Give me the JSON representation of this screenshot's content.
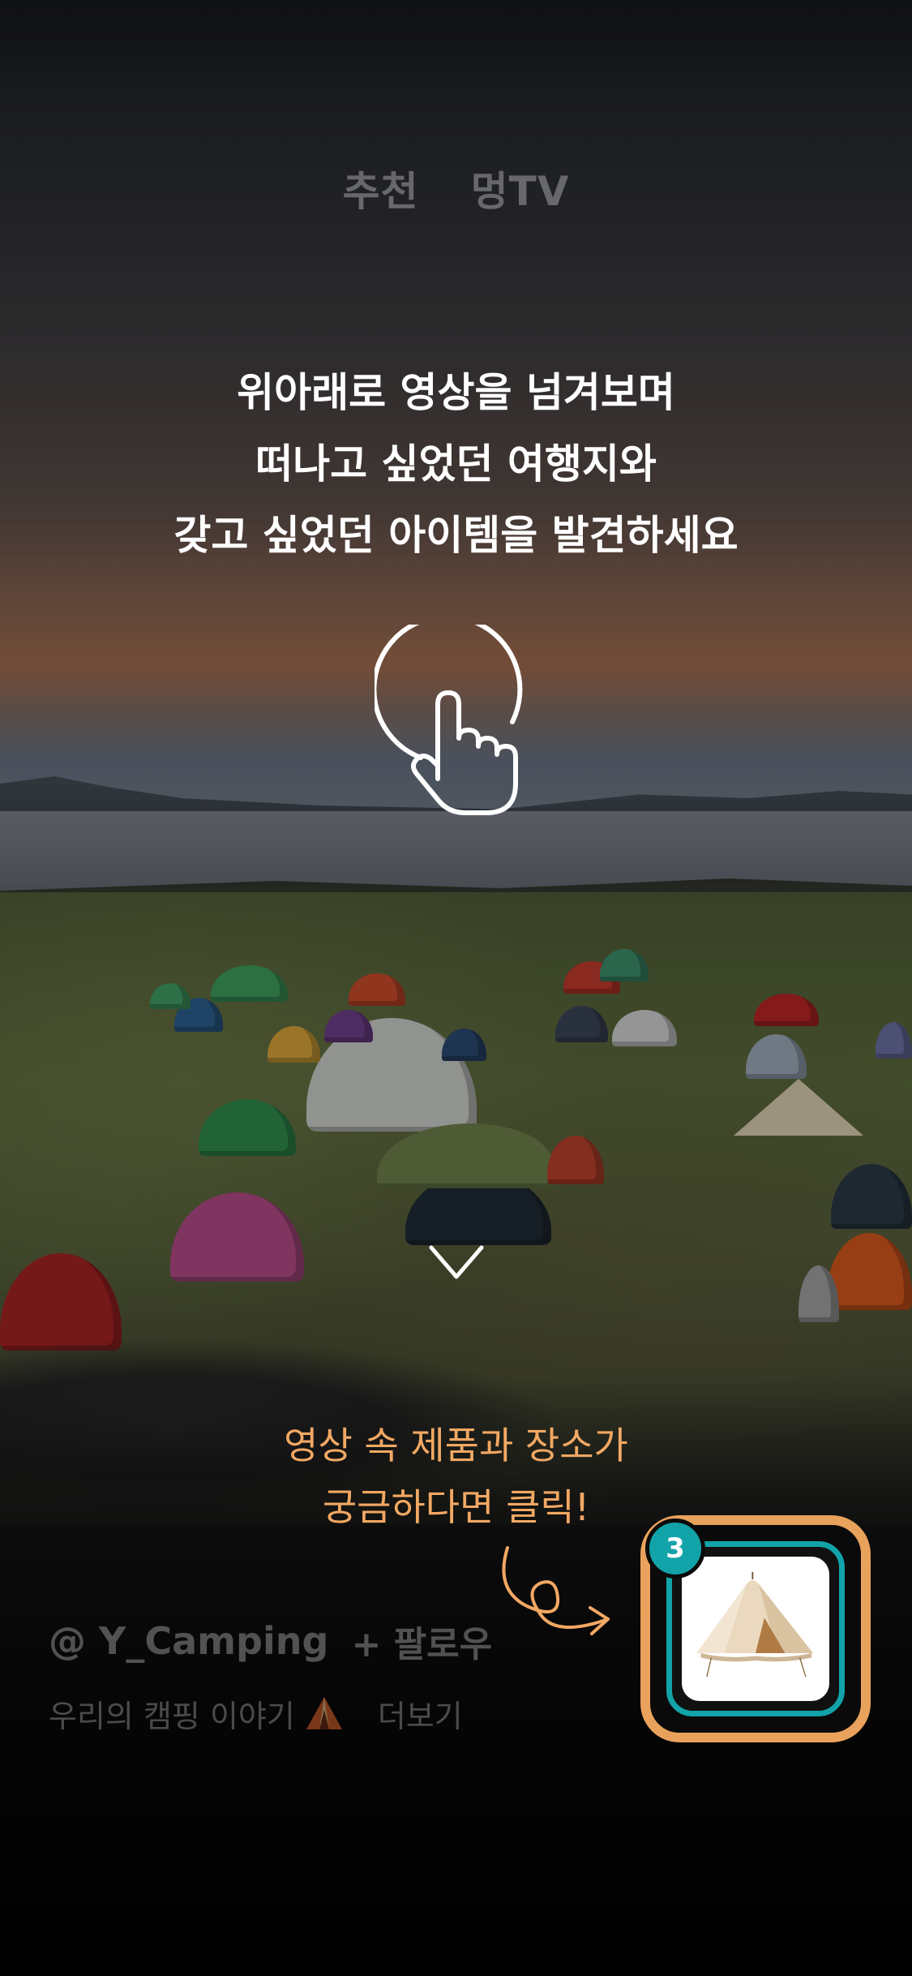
{
  "top_tabs": [
    {
      "label": "추천"
    },
    {
      "label": "멍TV"
    }
  ],
  "coach": {
    "lines": [
      "위아래로 영상을 넘겨보며",
      "떠나고 싶었던 여행지와",
      "갖고 싶었던 아이템을 발견하세요"
    ],
    "gesture_icon": "tap-hand-icon",
    "scroll_icon": "arrow-down-icon"
  },
  "product_hint": {
    "lines": [
      "영상 속 제품과 장소가",
      "궁금하다면 클릭!"
    ],
    "color": "#f2a863"
  },
  "product": {
    "count": "3",
    "image": "bell-tent-image",
    "frame_color": "#e9a25c",
    "accent_color": "#12a3a9"
  },
  "creator": {
    "handle": "@ Y_Camping",
    "follow_label": "+ 팔로우"
  },
  "caption": {
    "text": "우리의 캠핑 이야기",
    "emoji": "tent-emoji",
    "more_label": "더보기"
  }
}
